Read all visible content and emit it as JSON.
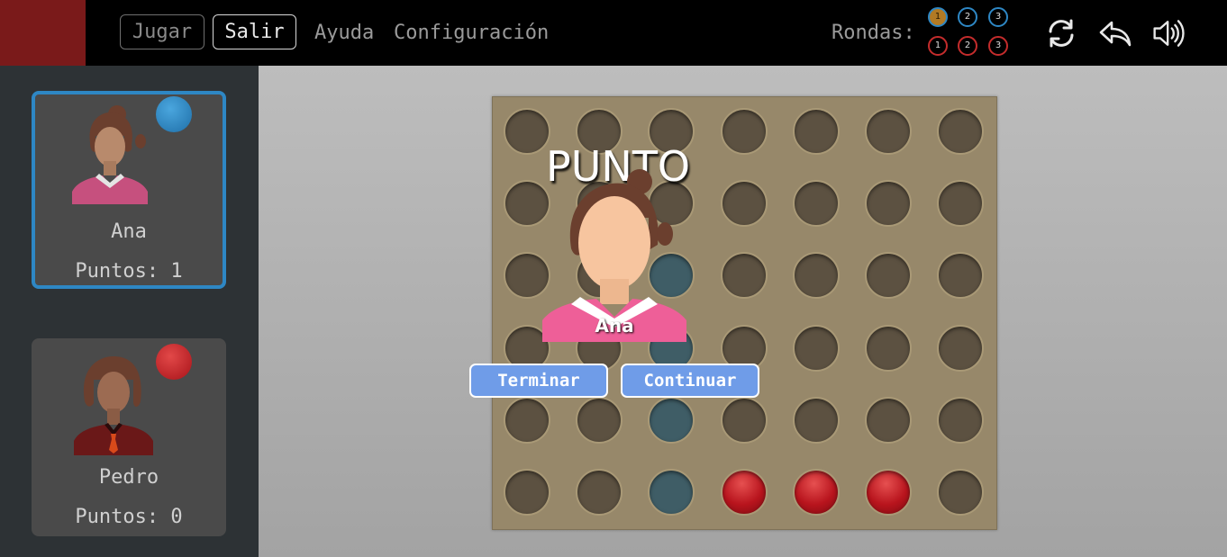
{
  "menu": {
    "jugar": "Jugar",
    "salir": "Salir",
    "ayuda": "Ayuda",
    "configuracion": "Configuración"
  },
  "rounds": {
    "label": "Rondas:",
    "blue": [
      "1",
      "2",
      "3"
    ],
    "red": [
      "1",
      "2",
      "3"
    ],
    "current_round": 1
  },
  "toolbar_icons": [
    "refresh-icon",
    "undo-icon",
    "volume-icon"
  ],
  "players": [
    {
      "name": "Ana",
      "score": "Puntos: 1",
      "chip_color": "#2e87c4",
      "active": true
    },
    {
      "name": "Pedro",
      "score": "Puntos: 0",
      "chip_color": "#c42c2c",
      "active": false
    }
  ],
  "board": {
    "cols": 7,
    "rows": 6,
    "cells": [
      [
        "e",
        "e",
        "e",
        "e",
        "e",
        "e",
        "e"
      ],
      [
        "e",
        "e",
        "e",
        "e",
        "e",
        "e",
        "e"
      ],
      [
        "e",
        "e",
        "b",
        "e",
        "e",
        "e",
        "e"
      ],
      [
        "e",
        "e",
        "b",
        "e",
        "e",
        "e",
        "e"
      ],
      [
        "e",
        "e",
        "b",
        "e",
        "e",
        "e",
        "e"
      ],
      [
        "e",
        "e",
        "b",
        "r",
        "r",
        "r",
        "e"
      ]
    ]
  },
  "overlay": {
    "title": "PUNTO",
    "winner_name": "Ana",
    "terminar": "Terminar",
    "continuar": "Continuar"
  },
  "colors": {
    "accent_red_block": "#7a1a1a",
    "player_blue": "#2e87c4",
    "player_red": "#c42c2c",
    "button_blue": "#6f9ce8"
  }
}
